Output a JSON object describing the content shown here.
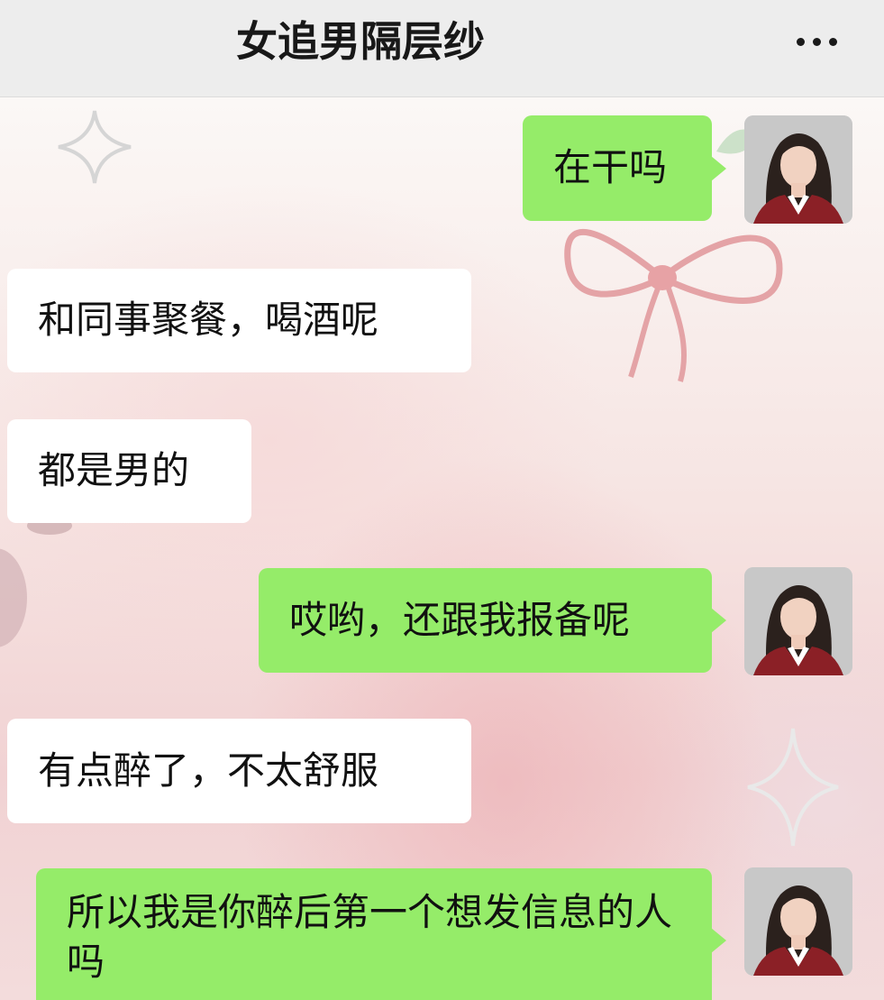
{
  "header": {
    "title": "女追男隔层纱",
    "more_icon": "more-dots-icon"
  },
  "colors": {
    "sent_bubble": "#95ec69",
    "received_bubble": "#ffffff",
    "header_bg": "#ededed"
  },
  "messages": [
    {
      "direction": "sent",
      "text": "在干吗",
      "avatar": "avatar-woman-icon"
    },
    {
      "direction": "received",
      "text": "和同事聚餐，喝酒呢"
    },
    {
      "direction": "received",
      "text": "都是男的"
    },
    {
      "direction": "sent",
      "text": "哎哟，还跟我报备呢",
      "avatar": "avatar-woman-icon"
    },
    {
      "direction": "received",
      "text": "有点醉了，不太舒服"
    },
    {
      "direction": "sent",
      "text": "所以我是你醉后第一个想发信息的人吗",
      "avatar": "avatar-woman-icon"
    }
  ]
}
